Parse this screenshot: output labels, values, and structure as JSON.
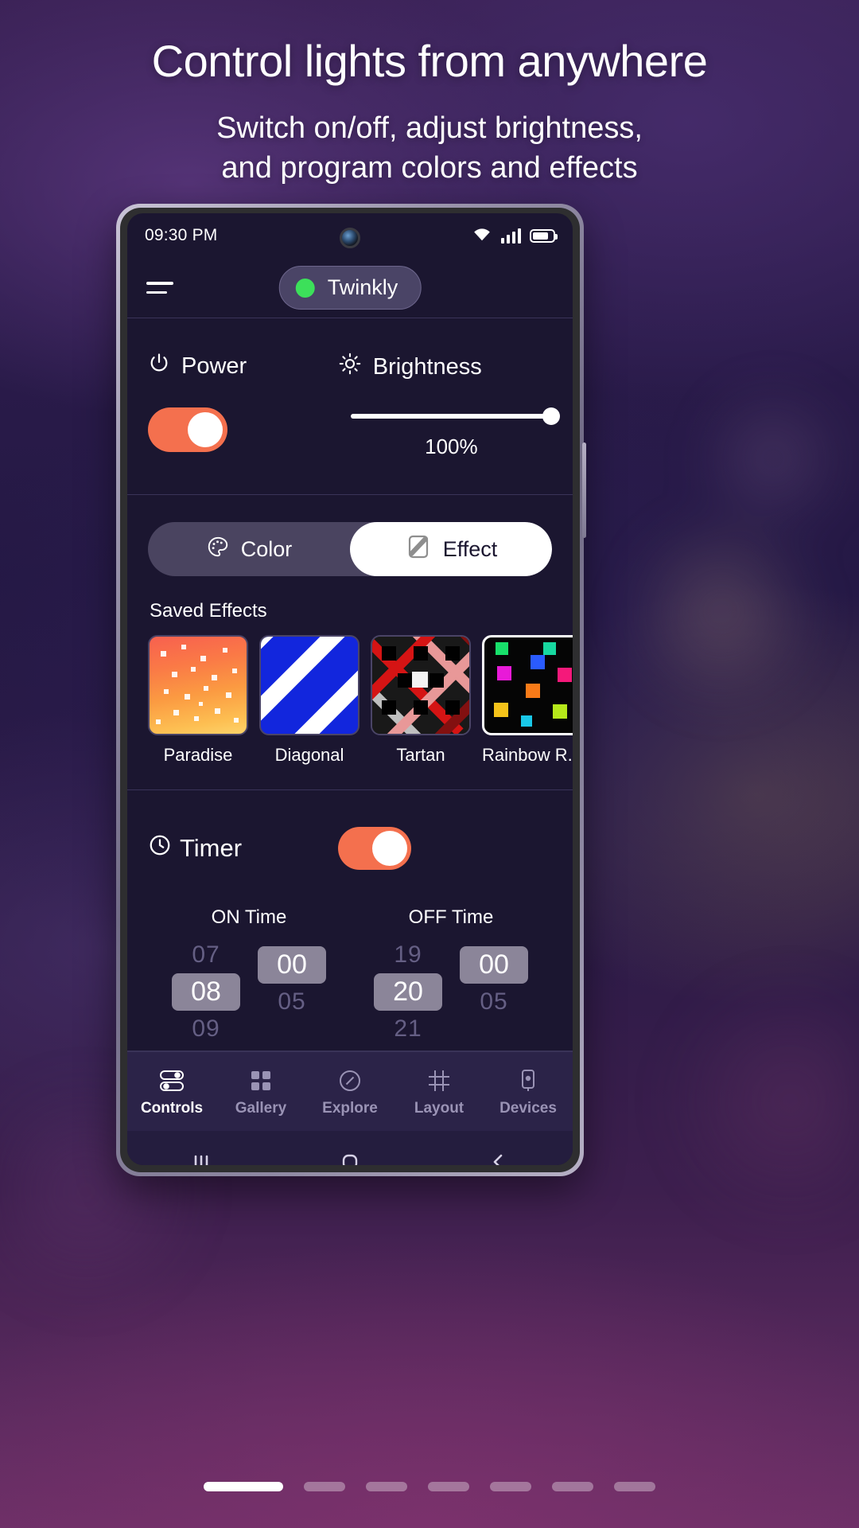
{
  "promo": {
    "headline": "Control lights from anywhere",
    "subhead_line1": "Switch on/off, adjust brightness,",
    "subhead_line2": "and program colors and effects"
  },
  "statusbar": {
    "time": "09:30 PM",
    "icons": [
      "wifi-icon",
      "signal-icon",
      "battery-icon"
    ]
  },
  "header": {
    "menu_icon": "hamburger-menu-icon",
    "device_name": "Twinkly",
    "status_dot_color": "#3ce05a"
  },
  "controls": {
    "power_label": "Power",
    "power_icon": "power-icon",
    "power_on": true,
    "brightness_label": "Brightness",
    "brightness_icon": "sun-icon",
    "brightness_value": "100%",
    "brightness_percent": 100,
    "accent_color": "#f4704e"
  },
  "mode_tabs": [
    {
      "label": "Color",
      "icon": "palette-icon",
      "active": false
    },
    {
      "label": "Effect",
      "icon": "effect-icon",
      "active": true
    }
  ],
  "effects": {
    "title": "Saved Effects",
    "items": [
      {
        "name": "Paradise",
        "selected": false
      },
      {
        "name": "Diagonal",
        "selected": false
      },
      {
        "name": "Tartan",
        "selected": false
      },
      {
        "name": "Rainbow R...",
        "selected": true
      }
    ]
  },
  "timer": {
    "label": "Timer",
    "icon": "clock-icon",
    "enabled": true,
    "on_time": {
      "title": "ON Time",
      "hour": {
        "prev": "07",
        "selected": "08",
        "next": "09"
      },
      "minute": {
        "prev": "",
        "selected": "00",
        "next": "05"
      }
    },
    "off_time": {
      "title": "OFF Time",
      "hour": {
        "prev": "19",
        "selected": "20",
        "next": "21"
      },
      "minute": {
        "prev": "",
        "selected": "00",
        "next": "05"
      }
    }
  },
  "bottom_nav": [
    {
      "label": "Controls",
      "icon": "sliders-icon",
      "active": true
    },
    {
      "label": "Gallery",
      "icon": "grid-icon",
      "active": false
    },
    {
      "label": "Explore",
      "icon": "compass-icon",
      "active": false
    },
    {
      "label": "Layout",
      "icon": "hash-grid-icon",
      "active": false
    },
    {
      "label": "Devices",
      "icon": "device-icon",
      "active": false
    }
  ],
  "system_nav": [
    "recents-icon",
    "home-icon",
    "back-icon"
  ],
  "pagination": {
    "count": 7,
    "active_index": 0
  }
}
